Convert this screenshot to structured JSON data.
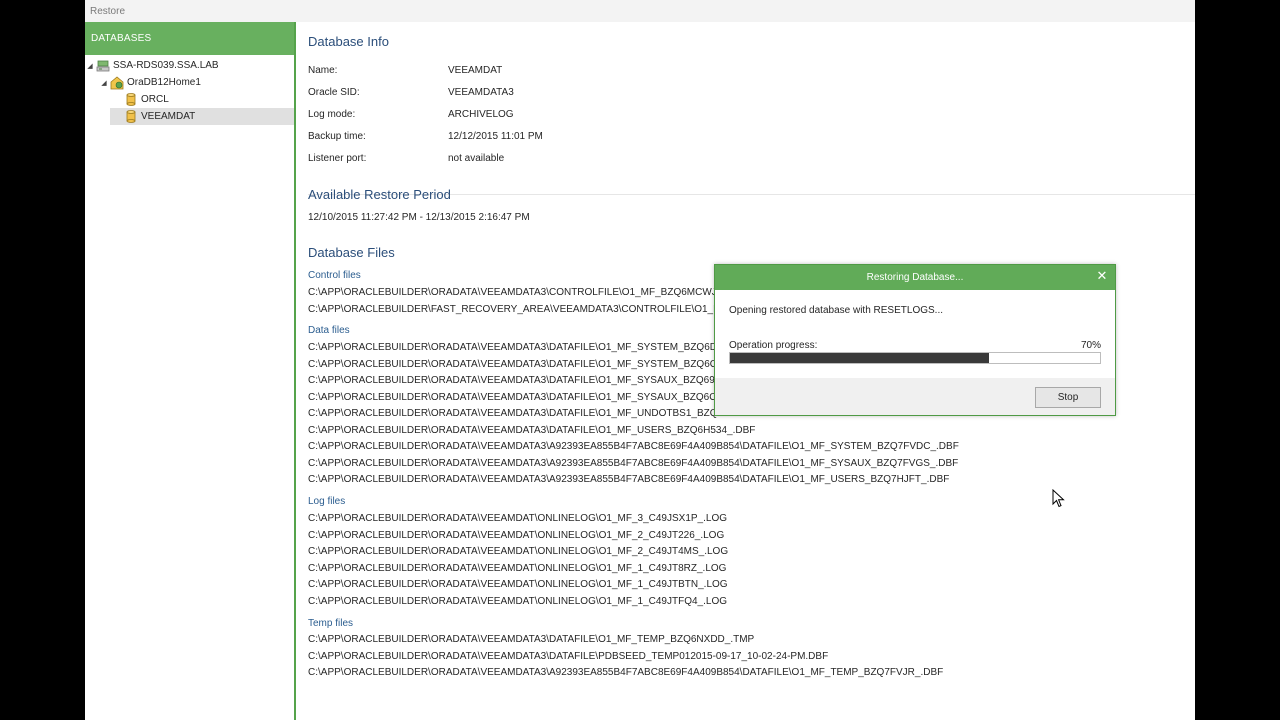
{
  "window": {
    "title": "Restore"
  },
  "sidebar": {
    "header": "DATABASES",
    "tree": [
      {
        "label": "SSA-RDS039.SSA.LAB",
        "icon": "server-icon",
        "expanded": true
      },
      {
        "label": "OraDB12Home1",
        "icon": "oracle-home-icon",
        "expanded": true
      },
      {
        "label": "ORCL",
        "icon": "database-icon"
      },
      {
        "label": "VEEAMDAT",
        "icon": "database-icon",
        "selected": true
      }
    ]
  },
  "db_info": {
    "title": "Database Info",
    "rows": [
      {
        "key": "Name:",
        "value": "VEEAMDAT"
      },
      {
        "key": "Oracle SID:",
        "value": "VEEAMDATA3"
      },
      {
        "key": "Log mode:",
        "value": "ARCHIVELOG"
      },
      {
        "key": "Backup time:",
        "value": "12/12/2015 11:01 PM"
      },
      {
        "key": "Listener port:",
        "value": "not available"
      }
    ]
  },
  "restore_period": {
    "title": "Available Restore Period",
    "value": "12/10/2015 11:27:42 PM - 12/13/2015 2:16:47 PM"
  },
  "db_files": {
    "title": "Database Files",
    "control": {
      "title": "Control files",
      "files": [
        "C:\\APP\\ORACLEBUILDER\\ORADATA\\VEEAMDATA3\\CONTROLFILE\\O1_MF_BZQ6MCWJ_",
        "C:\\APP\\ORACLEBUILDER\\FAST_RECOVERY_AREA\\VEEAMDATA3\\CONTROLFILE\\O1_MF_"
      ]
    },
    "data": {
      "title": "Data files",
      "files": [
        "C:\\APP\\ORACLEBUILDER\\ORADATA\\VEEAMDATA3\\DATAFILE\\O1_MF_SYSTEM_BZQ6D5",
        "C:\\APP\\ORACLEBUILDER\\ORADATA\\VEEAMDATA3\\DATAFILE\\O1_MF_SYSTEM_BZQ6O4",
        "C:\\APP\\ORACLEBUILDER\\ORADATA\\VEEAMDATA3\\DATAFILE\\O1_MF_SYSAUX_BZQ69S",
        "C:\\APP\\ORACLEBUILDER\\ORADATA\\VEEAMDATA3\\DATAFILE\\O1_MF_SYSAUX_BZQ6O4",
        "C:\\APP\\ORACLEBUILDER\\ORADATA\\VEEAMDATA3\\DATAFILE\\O1_MF_UNDOTBS1_BZQ6",
        "C:\\APP\\ORACLEBUILDER\\ORADATA\\VEEAMDATA3\\DATAFILE\\O1_MF_USERS_BZQ6H534_.DBF",
        "C:\\APP\\ORACLEBUILDER\\ORADATA\\VEEAMDATA3\\A92393EA855B4F7ABC8E69F4A409B854\\DATAFILE\\O1_MF_SYSTEM_BZQ7FVDC_.DBF",
        "C:\\APP\\ORACLEBUILDER\\ORADATA\\VEEAMDATA3\\A92393EA855B4F7ABC8E69F4A409B854\\DATAFILE\\O1_MF_SYSAUX_BZQ7FVGS_.DBF",
        "C:\\APP\\ORACLEBUILDER\\ORADATA\\VEEAMDATA3\\A92393EA855B4F7ABC8E69F4A409B854\\DATAFILE\\O1_MF_USERS_BZQ7HJFT_.DBF"
      ]
    },
    "log": {
      "title": "Log files",
      "files": [
        "C:\\APP\\ORACLEBUILDER\\ORADATA\\VEEAMDAT\\ONLINELOG\\O1_MF_3_C49JSX1P_.LOG",
        "C:\\APP\\ORACLEBUILDER\\ORADATA\\VEEAMDAT\\ONLINELOG\\O1_MF_2_C49JT226_.LOG",
        "C:\\APP\\ORACLEBUILDER\\ORADATA\\VEEAMDAT\\ONLINELOG\\O1_MF_2_C49JT4MS_.LOG",
        "C:\\APP\\ORACLEBUILDER\\ORADATA\\VEEAMDAT\\ONLINELOG\\O1_MF_1_C49JT8RZ_.LOG",
        "C:\\APP\\ORACLEBUILDER\\ORADATA\\VEEAMDAT\\ONLINELOG\\O1_MF_1_C49JTBTN_.LOG",
        "C:\\APP\\ORACLEBUILDER\\ORADATA\\VEEAMDAT\\ONLINELOG\\O1_MF_1_C49JTFQ4_.LOG"
      ]
    },
    "temp": {
      "title": "Temp files",
      "files": [
        "C:\\APP\\ORACLEBUILDER\\ORADATA\\VEEAMDATA3\\DATAFILE\\O1_MF_TEMP_BZQ6NXDD_.TMP",
        "C:\\APP\\ORACLEBUILDER\\ORADATA\\VEEAMDATA3\\DATAFILE\\PDBSEED_TEMP012015-09-17_10-02-24-PM.DBF",
        "C:\\APP\\ORACLEBUILDER\\ORADATA\\VEEAMDATA3\\A92393EA855B4F7ABC8E69F4A409B854\\DATAFILE\\O1_MF_TEMP_BZQ7FVJR_.DBF"
      ]
    }
  },
  "dialog": {
    "title": "Restoring Database...",
    "message": "Opening restored database with RESETLOGS...",
    "progress_label": "Operation progress:",
    "progress_text": "70%",
    "progress_value": 0.7,
    "stop_label": "Stop",
    "close_glyph": "✕"
  },
  "colors": {
    "accent_green": "#68b05f",
    "heading_blue": "#2b4e7a",
    "progress_fill": "#3a3a3a"
  }
}
